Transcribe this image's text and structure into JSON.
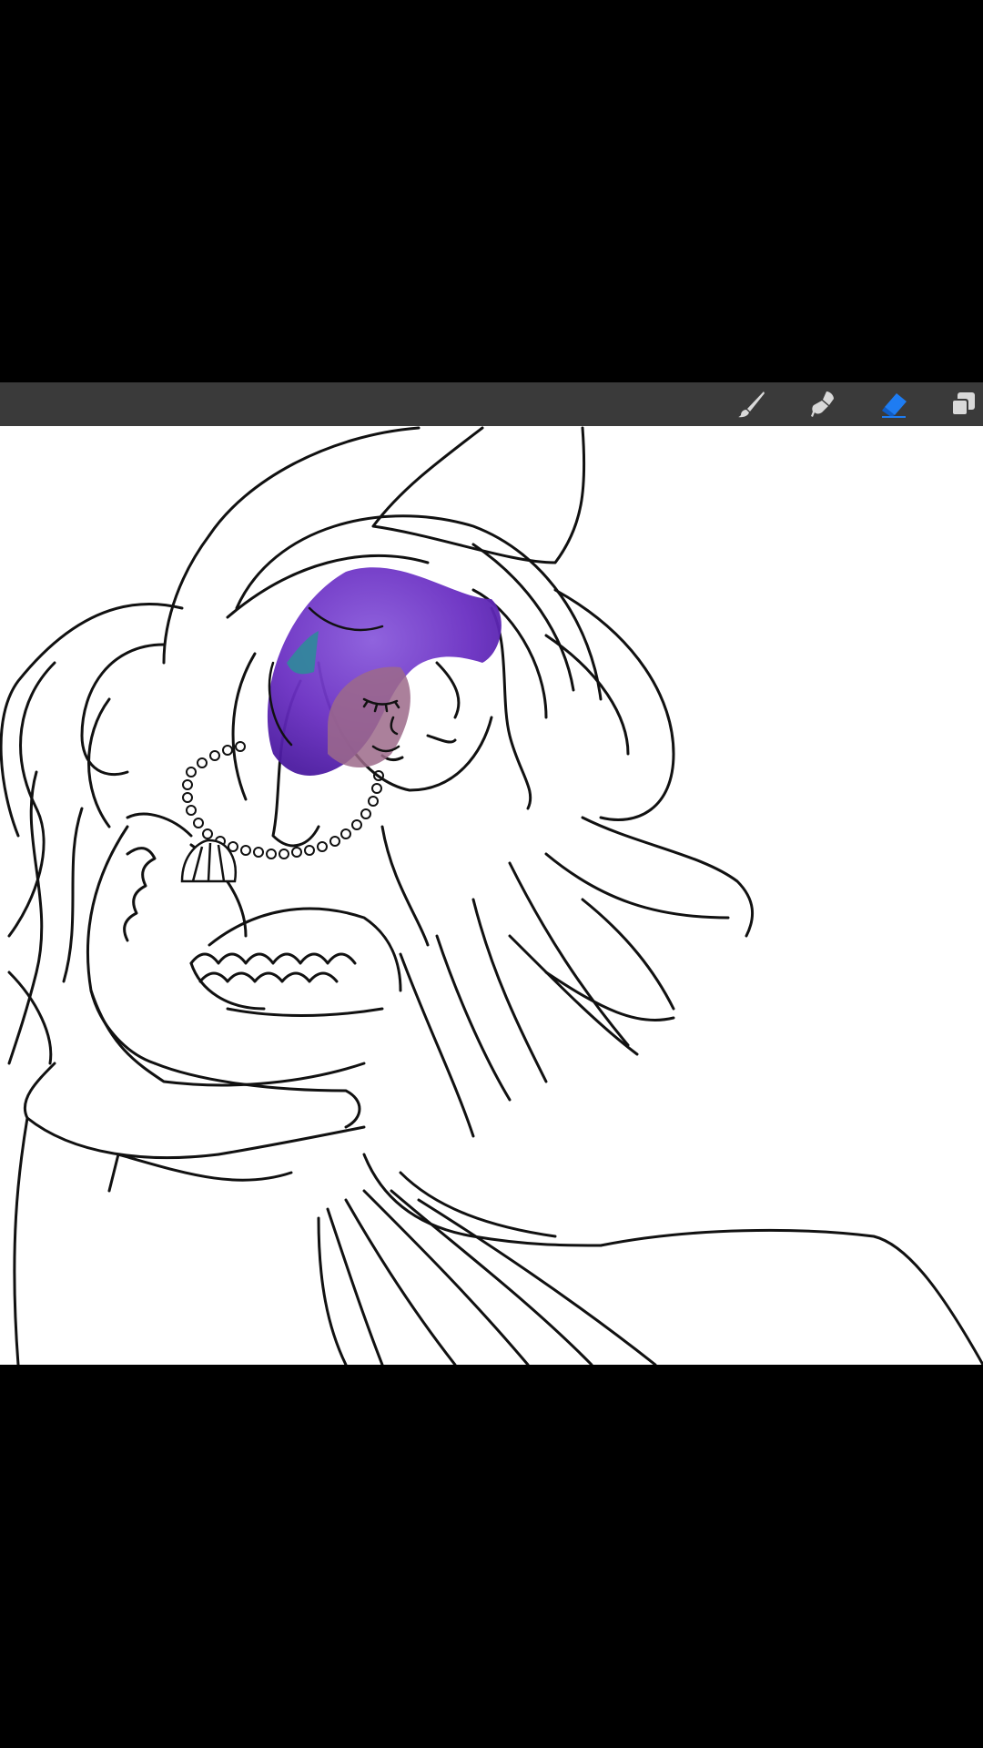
{
  "toolbar": {
    "tools": [
      {
        "name": "brush-tool",
        "icon": "brush-icon",
        "active": false
      },
      {
        "name": "smudge-tool",
        "icon": "smudge-icon",
        "active": false
      },
      {
        "name": "eraser-tool",
        "icon": "eraser-icon",
        "active": true
      },
      {
        "name": "layers-tool",
        "icon": "layers-icon",
        "active": false
      }
    ],
    "active_color": "#1e7cf2",
    "inactive_color": "#d9d9d9"
  },
  "canvas": {
    "background": "#ffffff",
    "line_color": "#111111",
    "hair_color": "#6a2fc2",
    "skin_color": "#9c6a8a",
    "fin_color": "#2f8a9a"
  }
}
